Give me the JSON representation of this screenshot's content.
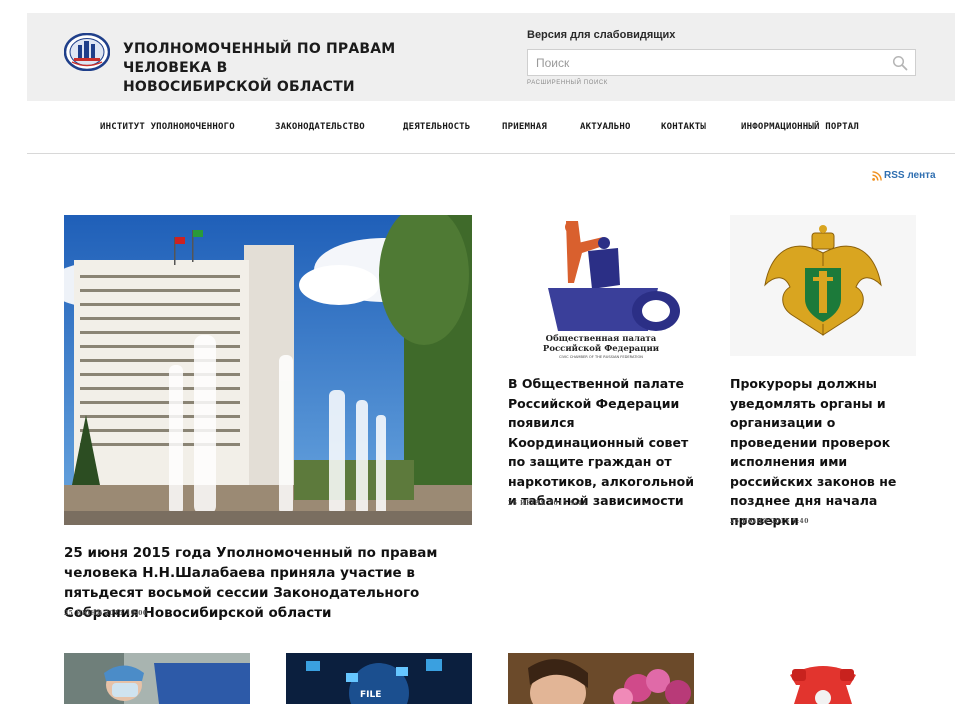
{
  "header": {
    "title_line1": "УПОЛНОМОЧЕННЫЙ ПО ПРАВАМ ЧЕЛОВЕКА В",
    "title_line2": "НОВОСИБИРСКОЙ ОБЛАСТИ",
    "vision_link": "Версия для слабовидящих",
    "search_placeholder": "Поиск",
    "advanced_search": "РАСШИРЕННЫЙ ПОИСК"
  },
  "nav": {
    "items": [
      {
        "label": "ИНСТИТУТ УПОЛНОМОЧЕННОГО"
      },
      {
        "label": "ЗАКОНОДАТЕЛЬСТВО"
      },
      {
        "label": "ДЕЯТЕЛЬНОСТЬ"
      },
      {
        "label": "ПРИЕМНАЯ"
      },
      {
        "label": "АКТУАЛЬНО"
      },
      {
        "label": "КОНТАКТЫ"
      },
      {
        "label": "ИНФОРМАЦИОННЫЙ ПОРТАЛ"
      }
    ]
  },
  "rss": {
    "label": "RSS лента"
  },
  "news": [
    {
      "title": "25 июня 2015 года Уполномоченный по правам человека Н.Н.Шалабаева приняла участие в пятьдесят восьмой сессии Законодательного Собрания Новосибирской области",
      "date": "25 ИЮНЯ 2015 10:00"
    },
    {
      "title": "В Общественной палате Российской Федерации появился Координационный совет по защите граждан от наркотиков, алкогольной и табачной зависимости",
      "date": "26 ИЮНЯ 2015 9:43",
      "image_caption_1": "Общественная палата",
      "image_caption_2": "Российской Федерации",
      "image_caption_3": "CIVIC CHAMBER OF THE RUSSIAN FEDERATION"
    },
    {
      "title": "Прокуроры должны уведомлять органы и организации о проведении проверок исполнения ими российских законов не позднее дня начала проверки",
      "date": "26 ИЮНЯ 2015 9:40"
    }
  ],
  "thumb_labels": {
    "file": "FILE"
  },
  "colors": {
    "header_bg": "#efefef",
    "link_blue": "#2e6eb0",
    "rss_orange": "#f0901e"
  }
}
